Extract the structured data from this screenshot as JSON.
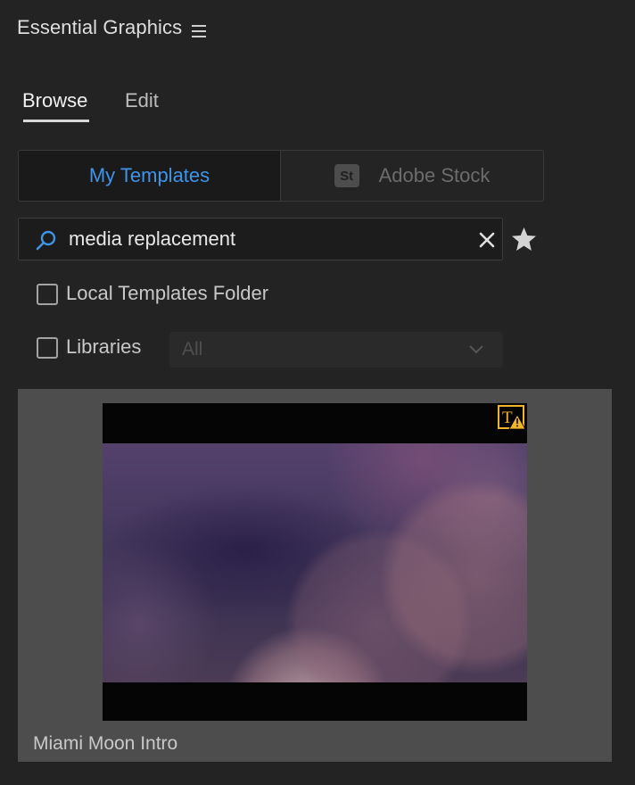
{
  "panel": {
    "title": "Essential Graphics",
    "menu_icon": "hamburger-menu-icon"
  },
  "tabs": [
    {
      "label": "Browse",
      "active": true
    },
    {
      "label": "Edit",
      "active": false
    }
  ],
  "source_toggle": {
    "my_templates_label": "My Templates",
    "adobe_stock_badge": "St",
    "adobe_stock_label": "Adobe Stock",
    "selected": "My Templates"
  },
  "search": {
    "value": "media replacement",
    "placeholder": "",
    "icon": "search-icon",
    "clear_icon": "close-icon",
    "favorites_icon": "star-icon"
  },
  "filters": {
    "local_templates_folder": {
      "label": "Local Templates Folder",
      "checked": false
    },
    "libraries": {
      "label": "Libraries",
      "checked": false
    },
    "libraries_dropdown": {
      "value": "All",
      "disabled": true
    }
  },
  "templates": [
    {
      "name": "Miami Moon Intro",
      "warning_icon": "missing-font-warning-icon"
    }
  ],
  "colors": {
    "accent": "#3f94ea",
    "panel_bg": "#232323",
    "warning": "#f0b429"
  }
}
